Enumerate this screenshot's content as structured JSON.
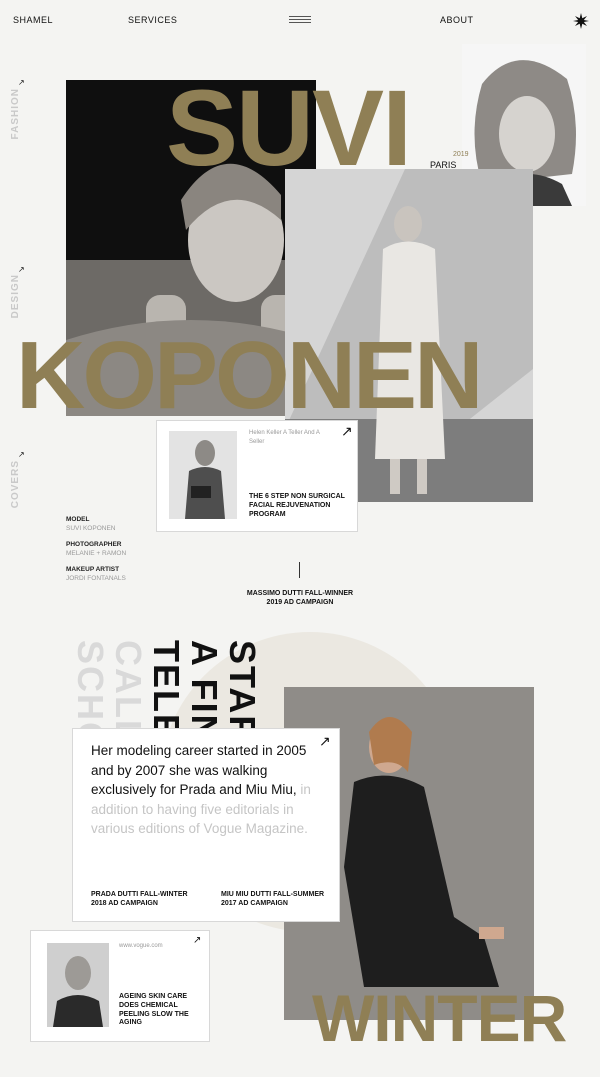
{
  "nav": {
    "brand": "SHAMEL",
    "services": "SERVICES",
    "about": "ABOUT",
    "menu_icon": "hamburger-icon",
    "star_icon": "star-icon"
  },
  "side_labels": [
    "FASHION",
    "DESIGN",
    "COVERS"
  ],
  "hero": {
    "title_first": "SUVI",
    "title_last": "KOPONEN",
    "year": "2019",
    "city": "PARIS"
  },
  "promo_card_top": {
    "tagline": "Helen Keller A Teller And A Seller",
    "title": "THE 6 STEP NON SURGICAL FACIAL REJUVENATION PROGRAM"
  },
  "credits": [
    {
      "label": "MODEL",
      "value": "SUVI KOPONEN"
    },
    {
      "label": "PHOTOGRAPHER",
      "value": "MELANIE + RAMON"
    },
    {
      "label": "MAKEUP ARTIST",
      "value": "JORDI FONTANALS"
    }
  ],
  "campaign_top": "MASSIMO DUTTI FALL-WINNER 2019 AD CAMPAIGN",
  "vertical_words": {
    "col1": "STAR",
    "col2": "A FIN",
    "col3": "TELE",
    "col4": "CALL",
    "col5": "SCHO"
  },
  "story": {
    "dark_text": "Her modeling career started in 2005 and by 2007 she was walking exclusively for Prada and Miu Miu,",
    "light_text": "in addition to having five editorials in various editions of Vogue Magazine.",
    "campaign_left": "PRADA DUTTI FALL-WINTER 2018 AD CAMPAIGN",
    "campaign_right": "MIU MIU DUTTI FALL-SUMMER 2017 AD CAMPAIGN"
  },
  "promo_card_bottom": {
    "tagline": "www.vogue.com",
    "title": "AGEING SKIN CARE DOES CHEMICAL PEELING SLOW THE AGING"
  },
  "winter": "WINTER",
  "colors": {
    "accent": "#8f7f55",
    "background": "#f4f4f2"
  }
}
